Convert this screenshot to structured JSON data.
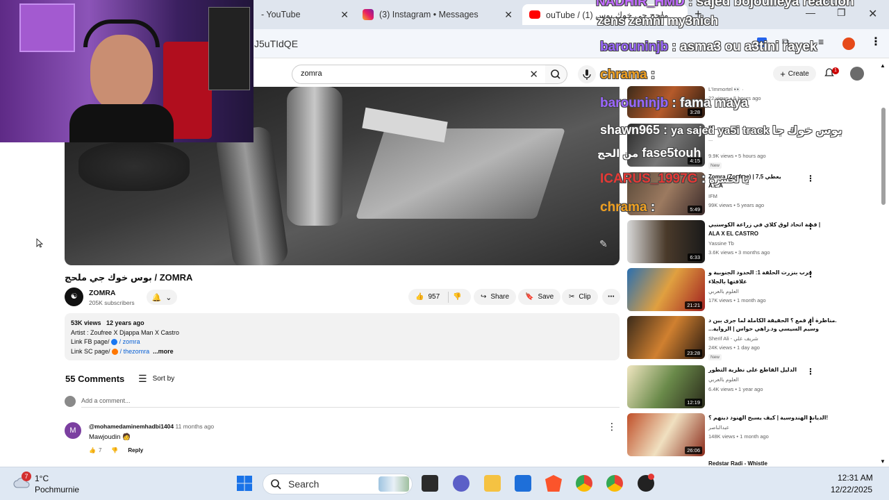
{
  "browser": {
    "tabs": [
      {
        "label": "- YouTube",
        "active": false
      },
      {
        "label": "(3) Instagram • Messages",
        "active": false
      },
      {
        "label": "(1) بوس خوك جي ملحج / ZOMRA - YouTube",
        "display": "ouTube / ملحج جي خوك بوس (1)",
        "active": true
      }
    ],
    "address_fragment": "J5uTIdQE",
    "new_tab": "+"
  },
  "youtube": {
    "search_value": "zomra",
    "create_label": "Create",
    "notification_count": "1",
    "video_title": "بوس خوك جي ملحج / ZOMRA",
    "channel_name": "ZOMRA",
    "channel_subs": "205K subscribers",
    "likes": "957",
    "share_label": "Share",
    "save_label": "Save",
    "clip_label": "Clip",
    "description": {
      "views": "53K views",
      "age": "12 years ago",
      "artist_line": "Artist : Zoufree X Djappa Man X Castro",
      "fb_line_prefix": "Link FB page/",
      "fb_link": "/ zomra",
      "sc_line_prefix": "Link SC page/",
      "sc_link": "/ thezomra",
      "more": "...more"
    },
    "comments_count": "55 Comments",
    "sort_label": "Sort by",
    "add_comment_placeholder": "Add a comment...",
    "comments": [
      {
        "avatar_letter": "M",
        "author": "@mohamedaminemhadbi1404",
        "time": "11 months ago",
        "text": "Mawjoudin 🧑",
        "likes": "7",
        "reply": "Reply"
      }
    ],
    "related": [
      {
        "title": "",
        "channel": "L'Immortel 👀 ·",
        "meta": "22 views • 5 hours ago",
        "duration": "3:28",
        "new": false
      },
      {
        "title": "Bl...",
        "channel": "...",
        "meta": "9.9K views • 5 hours ago",
        "duration": "4:15",
        "new": true,
        "new_label": "New"
      },
      {
        "title": "Zomra (Zoufree) | 7,5 يعطي",
        "title2": "A.L.A",
        "channel": "IFM",
        "meta": "99K views • 5 years ago",
        "duration": "5:49",
        "new": false
      },
      {
        "title": "قصة اتحاد لوق كلاي في زراعة الكوسنبي |",
        "title2": "ALA X EL CASTRO",
        "channel": "Yassine Tb",
        "meta": "3.6K views • 3 months ago",
        "duration": "6:33",
        "new": false
      },
      {
        "title": "حرب بنزرت الحلقة 1: الحدود الجنوبية و",
        "title2": "علاقتها بالجلاء",
        "channel": "العلوم بالعربي",
        "meta": "17K views • 1 month ago",
        "duration": "21:21",
        "new": false
      },
      {
        "title": "مناظرة أم قمع ؟ الحقيقة الكاملة لما جرى بين د.",
        "title2": "...وسيم السيسي ود.زاهي حواس | الرواية",
        "channel": "Sherif Ali - شريف علي",
        "meta": "24K views • 1 day ago",
        "duration": "23:28",
        "new": true,
        "new_label": "New"
      },
      {
        "title": "الدليل القاطع على نظرية التطور",
        "channel": "العلوم بالعربي",
        "meta": "6.4K views • 1 year ago",
        "duration": "12:19",
        "new": false
      },
      {
        "title": "الديانة الهندوسية | كيف يسبح الهنود دينهم ؟!",
        "channel": "عبدالناصر",
        "meta": "148K views • 1 month ago",
        "duration": "26:06",
        "new": false
      },
      {
        "title": "Redstar Radi - Whistle",
        "channel": "",
        "meta": "",
        "duration": "",
        "new": false
      }
    ]
  },
  "chat_overlay": [
    {
      "user": "NADHIR_HMD",
      "sep": " : ",
      "msg": "sajed bojoulleya reaction",
      "color": "#c06bff"
    },
    {
      "user": "",
      "sep": "",
      "msg": "zens zemni my3nich",
      "color": "#ffffff"
    },
    {
      "user": "barouninjb",
      "sep": " : ",
      "msg": "asma3 ou a3tini rayek",
      "color": "#9a66ff"
    },
    {
      "user": "chrama",
      "sep": " : ",
      "msg": "",
      "color": "#f0a020"
    },
    {
      "user": "barouninjb",
      "sep": " : ",
      "msg": "fama maya",
      "color": "#9a66ff"
    },
    {
      "user": "shawn965",
      "sep": " : ",
      "msg": "ya sajed ya5i track بوس خوك جا",
      "color": "#ffffff"
    },
    {
      "user": "fase5touh",
      "sep": "",
      "msg": "من الحج",
      "color": "#ffffff"
    },
    {
      "user": "ICARUS_1997G",
      "sep": " : ",
      "msg": "يا لحسرة",
      "color": "#e53935"
    },
    {
      "user": "chrama",
      "sep": " : ",
      "msg": "",
      "color": "#f0a020"
    }
  ],
  "taskbar": {
    "weather_badge": "7",
    "temperature": "1°C",
    "location": "Pochmurnie",
    "search_label": "Search",
    "time": "12:31 AM",
    "date": "12/22/2025"
  },
  "colors": {
    "youtube_red": "#ff0000",
    "chrome_tab_bg": "#dfe5ee",
    "taskbar_bg": "#dfe8f3"
  }
}
